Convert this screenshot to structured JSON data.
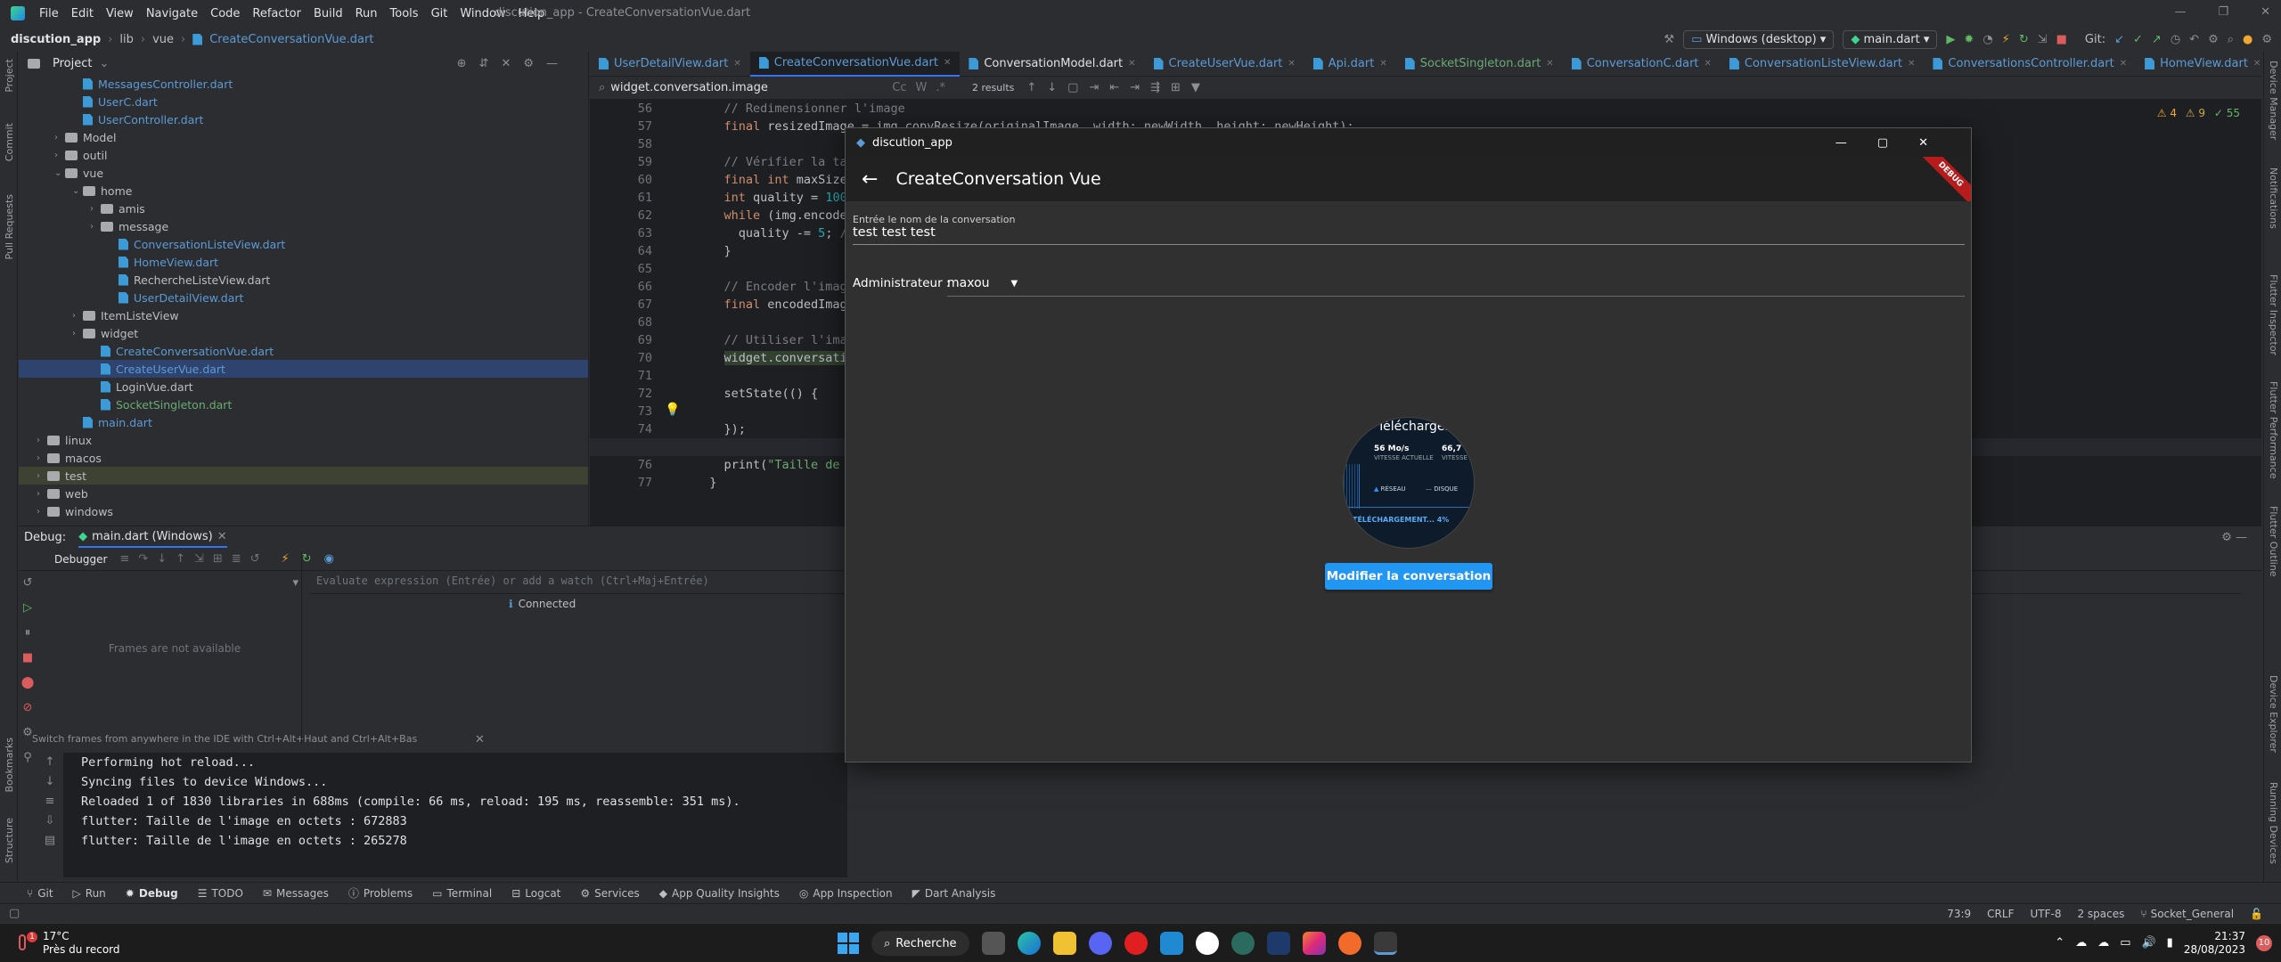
{
  "menu": {
    "items": [
      "File",
      "Edit",
      "View",
      "Navigate",
      "Code",
      "Refactor",
      "Build",
      "Run",
      "Tools",
      "Git",
      "Window",
      "Help"
    ],
    "title": "discution_app - CreateConversationVue.dart"
  },
  "nav": {
    "crumbs": [
      "discution_app",
      "lib",
      "vue",
      "CreateConversationVue.dart"
    ]
  },
  "run": {
    "device": "Windows (desktop)",
    "config": "main.dart",
    "git_label": "Git:"
  },
  "project": {
    "title": "Project",
    "rows": [
      {
        "label": "MessagesController.dart",
        "type": "dart",
        "indent": 3,
        "color": "#5c9bd6"
      },
      {
        "label": "UserC.dart",
        "type": "dart",
        "indent": 3,
        "color": "#5c9bd6"
      },
      {
        "label": "UserController.dart",
        "type": "dart",
        "indent": 3,
        "color": "#5c9bd6"
      },
      {
        "label": "Model",
        "type": "folder",
        "indent": 2,
        "caret": "›"
      },
      {
        "label": "outil",
        "type": "folder",
        "indent": 2,
        "caret": "›"
      },
      {
        "label": "vue",
        "type": "folder",
        "indent": 2,
        "caret": "⌄"
      },
      {
        "label": "home",
        "type": "folder",
        "indent": 3,
        "caret": "⌄"
      },
      {
        "label": "amis",
        "type": "folder",
        "indent": 4,
        "caret": "›"
      },
      {
        "label": "message",
        "type": "folder",
        "indent": 4,
        "caret": "›"
      },
      {
        "label": "ConversationListeView.dart",
        "type": "dart",
        "indent": 5,
        "color": "#5c9bd6"
      },
      {
        "label": "HomeView.dart",
        "type": "dart",
        "indent": 5,
        "color": "#5c9bd6"
      },
      {
        "label": "RechercheListeView.dart",
        "type": "dart",
        "indent": 5,
        "color": "#bcbec4"
      },
      {
        "label": "UserDetailView.dart",
        "type": "dart",
        "indent": 5,
        "color": "#5c9bd6"
      },
      {
        "label": "ItemListeView",
        "type": "folder",
        "indent": 3,
        "caret": "›"
      },
      {
        "label": "widget",
        "type": "folder",
        "indent": 3,
        "caret": "›"
      },
      {
        "label": "CreateConversationVue.dart",
        "type": "dart",
        "indent": 4,
        "color": "#5c9bd6"
      },
      {
        "label": "CreateUserVue.dart",
        "type": "dart",
        "indent": 4,
        "color": "#5c9bd6",
        "selected": true
      },
      {
        "label": "LoginVue.dart",
        "type": "dart",
        "indent": 4,
        "color": "#bcbec4"
      },
      {
        "label": "SocketSingleton.dart",
        "type": "dart",
        "indent": 4,
        "color": "#6aab73"
      },
      {
        "label": "main.dart",
        "type": "dart",
        "indent": 3,
        "color": "#5c9bd6"
      },
      {
        "label": "linux",
        "type": "folder",
        "indent": 1,
        "caret": "›"
      },
      {
        "label": "macos",
        "type": "folder",
        "indent": 1,
        "caret": "›"
      },
      {
        "label": "test",
        "type": "folder",
        "indent": 1,
        "caret": "›",
        "highlight": true
      },
      {
        "label": "web",
        "type": "folder",
        "indent": 1,
        "caret": "›"
      },
      {
        "label": "windows",
        "type": "folder",
        "indent": 1,
        "caret": "›"
      }
    ]
  },
  "tabs": [
    "UserDetailView.dart",
    "CreateConversationVue.dart",
    "ConversationModel.dart",
    "CreateUserVue.dart",
    "Api.dart",
    "SocketSingleton.dart",
    "ConversationC.dart",
    "ConversationListeView.dart",
    "ConversationsController.dart",
    "HomeView.dart"
  ],
  "active_tab": 1,
  "find": {
    "query": "widget.conversation.image",
    "results": "2 results",
    "cc": "Cc",
    "w": "W"
  },
  "inspections": {
    "warnings": "4",
    "weak": "9",
    "typos": "55"
  },
  "editor": {
    "lines": [
      {
        "n": "56",
        "html": "    <span class='cm'>// Redimensionner l'image</span>"
      },
      {
        "n": "57",
        "html": "    <span class='kw'>final</span> resizedImage = img.copyResize(originalImage, width: newWidth, height: newHeight);"
      },
      {
        "n": "58",
        "html": ""
      },
      {
        "n": "59",
        "html": "    <span class='cm'>// Vérifier la taille</span>"
      },
      {
        "n": "60",
        "html": "    <span class='kw'>final int</span> maxSize = <span class='nu'>5</span>"
      },
      {
        "n": "61",
        "html": "    <span class='kw'>int</span> quality = <span class='nu'>100</span>;"
      },
      {
        "n": "62",
        "html": "    <span class='kw'>while</span> (img.encodeJpg("
      },
      {
        "n": "63",
        "html": "      quality -= <span class='nu'>5</span>; <span class='cm'>// Ré</span>"
      },
      {
        "n": "64",
        "html": "    }"
      },
      {
        "n": "65",
        "html": ""
      },
      {
        "n": "66",
        "html": "    <span class='cm'>// Encoder l'image av</span>"
      },
      {
        "n": "67",
        "html": "    <span class='kw'>final</span> encodedImage = "
      },
      {
        "n": "68",
        "html": ""
      },
      {
        "n": "69",
        "html": "    <span class='cm'>// Utiliser l'image e</span>"
      },
      {
        "n": "70",
        "html": "    <span style='background:#32412f'>widget.conversation.i</span>"
      },
      {
        "n": "71",
        "html": ""
      },
      {
        "n": "72",
        "html": "    setState(() {"
      },
      {
        "n": "73",
        "html": ""
      },
      {
        "n": "74",
        "html": "    });"
      },
      {
        "n": "75",
        "html": ""
      },
      {
        "n": "76",
        "html": "    print(<span class='st'>\"Taille de l'im</span>"
      },
      {
        "n": "77",
        "html": "  }"
      }
    ]
  },
  "debug": {
    "label": "Debug:",
    "session": "main.dart (Windows)",
    "debugger_tab": "Debugger",
    "frames_empty": "Frames are not available",
    "eval_placeholder": "Evaluate expression (Entrée) or add a watch (Ctrl+Maj+Entrée)",
    "connected": "Connected",
    "hint": "Switch frames from anywhere in the IDE with Ctrl+Alt+Haut and Ctrl+Alt+Bas"
  },
  "console": [
    "Performing hot reload...",
    "Syncing files to device Windows...",
    "Reloaded 1 of 1830 libraries in 688ms (compile: 66 ms, reload: 195 ms, reassemble: 351 ms).",
    "flutter: Taille de l'image en octets : 672883",
    "flutter: Taille de l'image en octets : 265278"
  ],
  "left_tools": [
    "Project",
    "Commit",
    "Pull Requests",
    "Bookmarks",
    "Structure"
  ],
  "right_tools": [
    "Device Manager",
    "Notifications",
    "Flutter Inspector",
    "Flutter Performance",
    "Flutter Outline",
    "Device Explorer",
    "Running Devices"
  ],
  "bottom_tools": [
    "Git",
    "Run",
    "Debug",
    "TODO",
    "Messages",
    "Problems",
    "Terminal",
    "Logcat",
    "Services",
    "App Quality Insights",
    "App Inspection",
    "Dart Analysis"
  ],
  "status": {
    "position": "73:9",
    "line_sep": "CRLF",
    "encoding": "UTF-8",
    "indent": "2 spaces",
    "branch": "Socket_General"
  },
  "taskbar": {
    "weather_temp": "17°C",
    "weather_desc": "Près du record",
    "search_label": "Recherche",
    "time": "21:37",
    "date": "28/08/2023",
    "badge": "1",
    "notif_count": "10"
  },
  "app": {
    "window_title": "discution_app",
    "page_title": "CreateConversation Vue",
    "debug_banner": "DEBUG",
    "name_label": "Entrée le nom de la conversation",
    "name_value": "test test test",
    "admin_label": "Administrateur :",
    "admin_value": "maxou",
    "submit_label": "Modifier la conversation",
    "thumb": {
      "title": "Téléchargem",
      "speed1": "56 Mo/s",
      "speed1_label": "VITESSE ACTUELLE",
      "speed2": "66,7 M",
      "speed2_label": "VITESSE",
      "legend1": "RÉSEAU",
      "legend2": "DISQUE",
      "progress": "TÉLÉCHARGEMENT... 4%"
    }
  },
  "colors": {
    "accent": "#3574f0",
    "app_button": "#2196f3",
    "debug_banner": "#b71c1c"
  }
}
